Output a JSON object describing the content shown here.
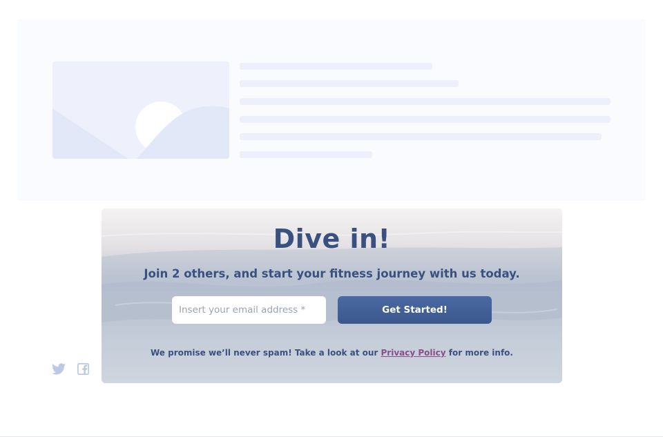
{
  "hero": {
    "title": "Dive in!",
    "subtitle": "Join 2 others, and start your fitness journey with us today.",
    "email_placeholder": "Insert your email address *",
    "email_value": "",
    "cta_label": "Get Started!",
    "note_prefix": "We promise we’ll never spam! Take a look at our",
    "note_link": "Privacy Policy",
    "note_suffix": "for more info."
  },
  "social": {
    "icons": [
      "twitter-icon",
      "facebook-icon"
    ]
  },
  "colors": {
    "heading": "#3a5180",
    "button": "#3b578d",
    "link": "#8a4f86",
    "skeleton": "#edf0fa"
  }
}
